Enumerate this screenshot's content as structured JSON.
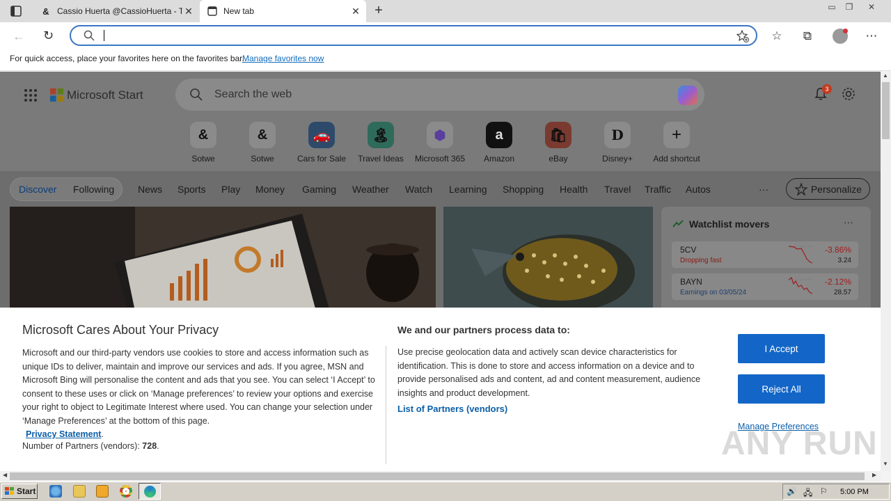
{
  "browser": {
    "tabs": [
      {
        "title": "Cassio Huerta @CassioHuerta - T",
        "favicon": "threads-icon",
        "active": false
      },
      {
        "title": "New tab",
        "favicon": "newtab-icon",
        "active": true
      }
    ],
    "address_value": "",
    "favorites_bar": {
      "message": "For quick access, place your favorites here on the favorites bar.",
      "link": "Manage favorites now"
    }
  },
  "page": {
    "brand": "Microsoft Start",
    "search_placeholder": "Search the web",
    "notifications_count": "3",
    "shortcuts": [
      {
        "label": "Sotwe",
        "icon": "threads-icon",
        "glyph": "&"
      },
      {
        "label": "Sotwe",
        "icon": "threads-icon",
        "glyph": "&"
      },
      {
        "label": "Cars for Sale",
        "icon": "car-icon",
        "glyph": "🚗"
      },
      {
        "label": "Travel Ideas",
        "icon": "island-icon",
        "glyph": "🏝"
      },
      {
        "label": "Microsoft 365",
        "icon": "m365-icon",
        "glyph": "⬢"
      },
      {
        "label": "Amazon",
        "icon": "amazon-icon",
        "glyph": "a"
      },
      {
        "label": "eBay",
        "icon": "ebay-icon",
        "glyph": "🛍"
      },
      {
        "label": "Disney+",
        "icon": "disney-icon",
        "glyph": "D"
      },
      {
        "label": "Add shortcut",
        "icon": "plus-icon",
        "glyph": "+"
      }
    ],
    "nav": {
      "pill": [
        "Discover",
        "Following"
      ],
      "items": [
        "News",
        "Sports",
        "Play",
        "Money",
        "Gaming",
        "Weather",
        "Watch",
        "Learning",
        "Shopping",
        "Health",
        "Travel",
        "Traffic",
        "Autos"
      ],
      "more": "···",
      "personalize": "Personalize"
    },
    "watchlist": {
      "title": "Watchlist movers",
      "more": "···",
      "rows": [
        {
          "symbol": "5CV",
          "note": "Dropping fast",
          "change": "-3.86%",
          "price": "3.24"
        },
        {
          "symbol": "BAYN",
          "note": "Earnings on 03/05/24",
          "change": "-2.12%",
          "price": "28.57"
        }
      ]
    }
  },
  "consent": {
    "title": "Microsoft Cares About Your Privacy",
    "body": "Microsoft and our third-party vendors use cookies to store and access information such as unique IDs to deliver, maintain and improve our services and ads. If you agree, MSN and Microsoft Bing will personalise the content and ads that you see. You can select ‘I Accept’ to consent to these uses or click on ‘Manage preferences’ to review your options and exercise your right to object to Legitimate Interest where used.  You can change your selection under ‘Manage Preferences’ at the bottom of this page.",
    "privacy_link": "Privacy Statement",
    "partners_count_label": "Number of Partners (vendors):",
    "partners_count": "728",
    "subtitle": "We and our partners process data to:",
    "purpose": "Use precise geolocation data and actively scan device characteristics for identification. This is done to store and access information on a device and to provide personalised ads and content, ad and content measurement, audience insights and product development.",
    "partners_link": "List of Partners (vendors)",
    "accept": "I Accept",
    "reject": "Reject All",
    "manage": "Manage Preferences"
  },
  "watermark": "ANY RUN",
  "taskbar": {
    "start": "Start",
    "clock": "5:00 PM"
  },
  "colors": {
    "accent": "#1366c7",
    "link": "#0b5ea8",
    "omnibox_border": "#3a75c4",
    "negative": "#9e1c1c"
  }
}
